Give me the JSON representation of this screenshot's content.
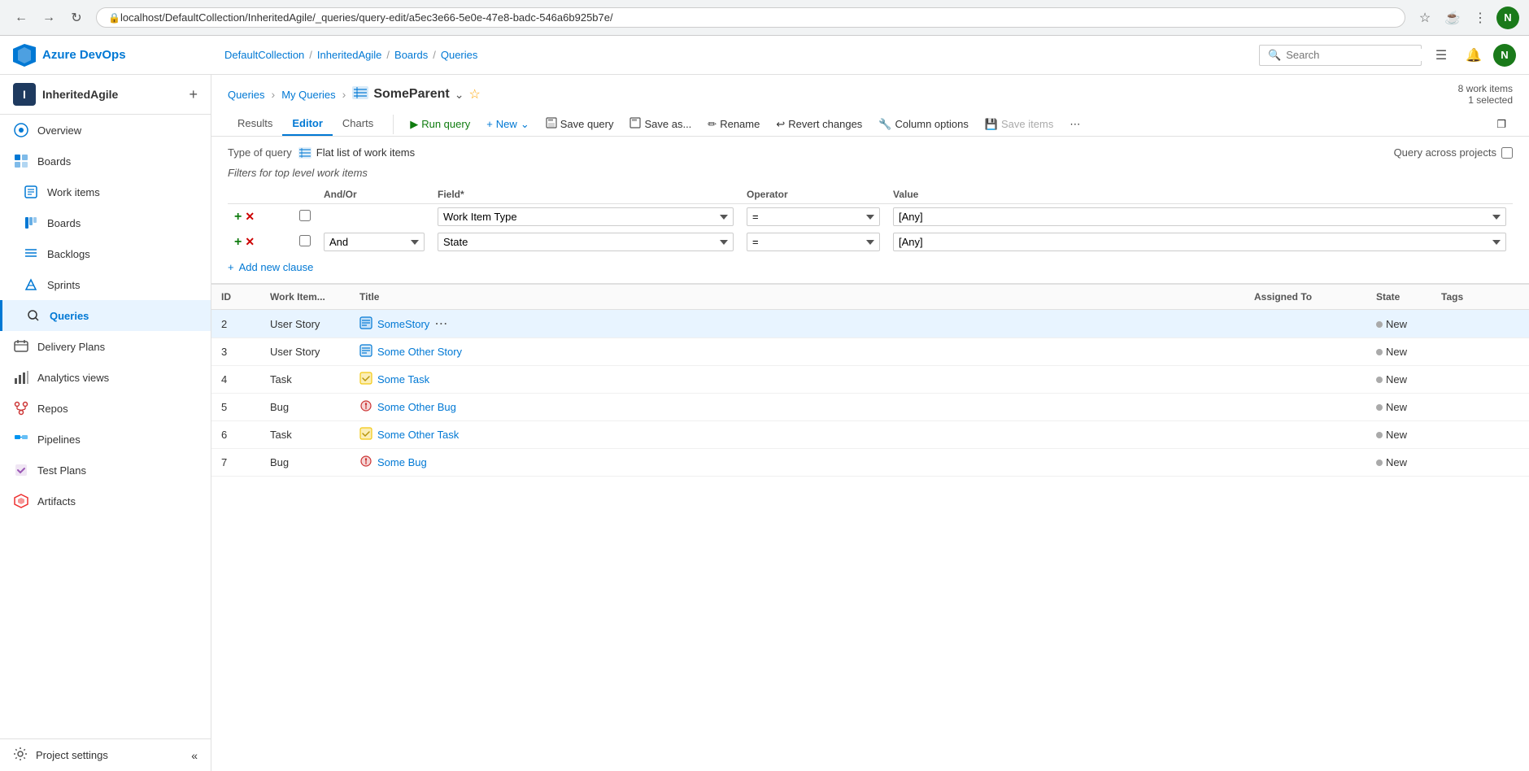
{
  "browser": {
    "url": "localhost/DefaultCollection/InheritedAgile/_queries/query-edit/a5ec3e66-5e0e-47e8-badc-546a6b925b7e/",
    "user_initial": "N"
  },
  "topnav": {
    "app_name": "Azure DevOps",
    "breadcrumb": [
      {
        "label": "DefaultCollection",
        "sep": "/"
      },
      {
        "label": "InheritedAgile",
        "sep": "/"
      },
      {
        "label": "Boards",
        "sep": "/"
      },
      {
        "label": "Queries",
        "sep": ""
      }
    ],
    "search_placeholder": "Search"
  },
  "sidebar": {
    "project_name": "InheritedAgile",
    "project_initial": "I",
    "items": [
      {
        "label": "Overview",
        "icon": "overview"
      },
      {
        "label": "Boards",
        "icon": "boards"
      },
      {
        "label": "Work items",
        "icon": "work-items"
      },
      {
        "label": "Boards",
        "icon": "boards-sub"
      },
      {
        "label": "Backlogs",
        "icon": "backlogs"
      },
      {
        "label": "Sprints",
        "icon": "sprints"
      },
      {
        "label": "Queries",
        "icon": "queries",
        "active": true
      },
      {
        "label": "Delivery Plans",
        "icon": "delivery-plans"
      },
      {
        "label": "Analytics views",
        "icon": "analytics-views"
      },
      {
        "label": "Repos",
        "icon": "repos"
      },
      {
        "label": "Pipelines",
        "icon": "pipelines"
      },
      {
        "label": "Test Plans",
        "icon": "test-plans"
      },
      {
        "label": "Artifacts",
        "icon": "artifacts"
      }
    ],
    "bottom_item": {
      "label": "Project settings",
      "icon": "settings"
    },
    "collapse_label": "Collapse"
  },
  "query": {
    "breadcrumb": [
      {
        "label": "Queries"
      },
      {
        "label": "My Queries"
      }
    ],
    "title": "SomeParent",
    "workitems_count": "8 work items",
    "selected_count": "1 selected",
    "tabs": [
      {
        "label": "Results"
      },
      {
        "label": "Editor",
        "active": true
      },
      {
        "label": "Charts"
      }
    ],
    "toolbar": {
      "run_query": "Run query",
      "new": "New",
      "save_query": "Save query",
      "save_as": "Save as...",
      "rename": "Rename",
      "revert_changes": "Revert changes",
      "column_options": "Column options",
      "save_items": "Save items",
      "more": "More"
    },
    "type_of_query_label": "Type of query",
    "type_of_query_value": "Flat list of work items",
    "query_across_projects": "Query across projects",
    "filters_label": "Filters for top level work items",
    "columns": {
      "and_or": "And/Or",
      "field": "Field*",
      "operator": "Operator",
      "value": "Value"
    },
    "filter_rows": [
      {
        "id": 1,
        "and_or": "",
        "field": "Work Item Type",
        "operator": "=",
        "value": "[Any]"
      },
      {
        "id": 2,
        "and_or": "And",
        "field": "State",
        "operator": "=",
        "value": "[Any]"
      }
    ],
    "add_clause_label": "Add new clause",
    "results_columns": [
      "ID",
      "Work Item...",
      "Title",
      "Assigned To",
      "State",
      "Tags"
    ],
    "results": [
      {
        "id": 2,
        "type": "User Story",
        "icon": "story",
        "title": "SomeStory",
        "assigned_to": "",
        "state": "New",
        "tags": "",
        "selected": true,
        "ellipsis": true
      },
      {
        "id": 3,
        "type": "User Story",
        "icon": "story",
        "title": "Some Other Story",
        "assigned_to": "",
        "state": "New",
        "tags": "",
        "selected": false
      },
      {
        "id": 4,
        "type": "Task",
        "icon": "task",
        "title": "Some Task",
        "assigned_to": "",
        "state": "New",
        "tags": "",
        "selected": false
      },
      {
        "id": 5,
        "type": "Bug",
        "icon": "bug",
        "title": "Some Other Bug",
        "assigned_to": "",
        "state": "New",
        "tags": "",
        "selected": false
      },
      {
        "id": 6,
        "type": "Task",
        "icon": "task",
        "title": "Some Other Task",
        "assigned_to": "",
        "state": "New",
        "tags": "",
        "selected": false
      },
      {
        "id": 7,
        "type": "Bug",
        "icon": "bug",
        "title": "Some Bug",
        "assigned_to": "",
        "state": "New",
        "tags": "",
        "selected": false
      }
    ]
  }
}
